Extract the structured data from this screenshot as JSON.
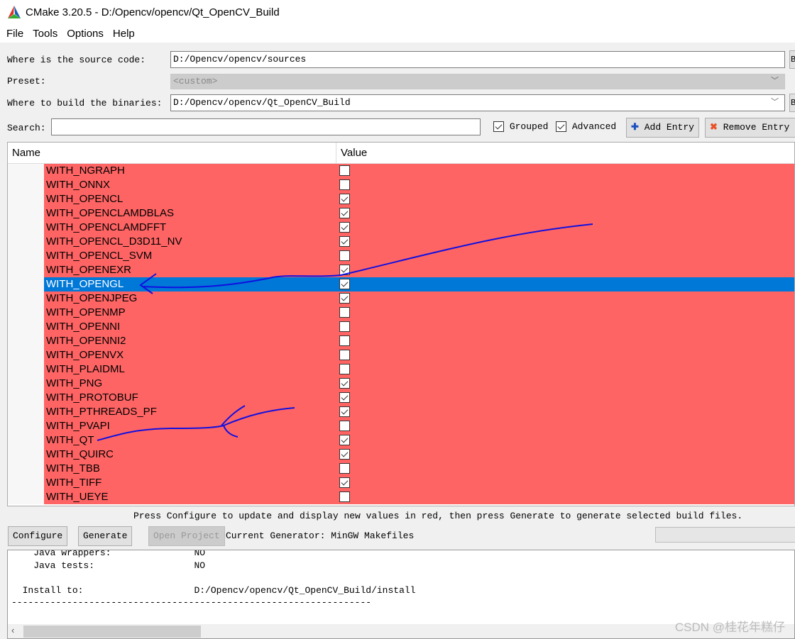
{
  "window": {
    "title": "CMake 3.20.5 - D:/Opencv/opencv/Qt_OpenCV_Build"
  },
  "menu": [
    "File",
    "Tools",
    "Options",
    "Help"
  ],
  "source": {
    "label": "Where is the source code:",
    "value": "D:/Opencv/opencv/sources",
    "browse": "B"
  },
  "preset": {
    "label": "Preset:",
    "value": "<custom>"
  },
  "build": {
    "label": "Where to build the binaries:",
    "value": "D:/Opencv/opencv/Qt_OpenCV_Build",
    "browse": "B"
  },
  "search": {
    "label": "Search:",
    "value": ""
  },
  "options": {
    "grouped": "Grouped",
    "grouped_checked": true,
    "advanced": "Advanced",
    "advanced_checked": true,
    "add_entry": "Add Entry",
    "remove_entry": "Remove Entry"
  },
  "table": {
    "headers": [
      "Name",
      "Value"
    ],
    "rows": [
      {
        "name": "WITH_NGRAPH",
        "value": false
      },
      {
        "name": "WITH_ONNX",
        "value": false
      },
      {
        "name": "WITH_OPENCL",
        "value": true
      },
      {
        "name": "WITH_OPENCLAMDBLAS",
        "value": true
      },
      {
        "name": "WITH_OPENCLAMDFFT",
        "value": true
      },
      {
        "name": "WITH_OPENCL_D3D11_NV",
        "value": true
      },
      {
        "name": "WITH_OPENCL_SVM",
        "value": false
      },
      {
        "name": "WITH_OPENEXR",
        "value": true
      },
      {
        "name": "WITH_OPENGL",
        "value": true,
        "selected": true
      },
      {
        "name": "WITH_OPENJPEG",
        "value": true
      },
      {
        "name": "WITH_OPENMP",
        "value": false
      },
      {
        "name": "WITH_OPENNI",
        "value": false
      },
      {
        "name": "WITH_OPENNI2",
        "value": false
      },
      {
        "name": "WITH_OPENVX",
        "value": false
      },
      {
        "name": "WITH_PLAIDML",
        "value": false
      },
      {
        "name": "WITH_PNG",
        "value": true
      },
      {
        "name": "WITH_PROTOBUF",
        "value": true
      },
      {
        "name": "WITH_PTHREADS_PF",
        "value": true
      },
      {
        "name": "WITH_PVAPI",
        "value": false
      },
      {
        "name": "WITH_QT",
        "value": true
      },
      {
        "name": "WITH_QUIRC",
        "value": true
      },
      {
        "name": "WITH_TBB",
        "value": false
      },
      {
        "name": "WITH_TIFF",
        "value": true
      },
      {
        "name": "WITH_UEYE",
        "value": false
      }
    ]
  },
  "status": "Press Configure to update and display new values in red, then press Generate to generate selected build files.",
  "buttons": {
    "configure": "Configure",
    "generate": "Generate",
    "open_project": "Open Project"
  },
  "generator": "Current Generator: MinGW Makefiles",
  "output": "    Java wrappers:               NO\n    Java tests:                  NO\n\n  Install to:                    D:/Opencv/opencv/Qt_OpenCV_Build/install\n-----------------------------------------------------------------",
  "watermark": "CSDN @桂花年糕仔",
  "colors": {
    "changed_row": "#ff6464",
    "selected_row": "#0078d7",
    "annotation_ink": "#1010e0"
  }
}
